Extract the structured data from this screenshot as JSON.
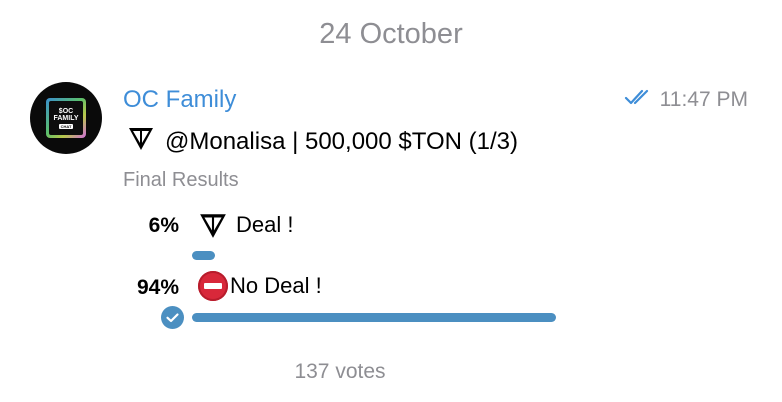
{
  "date_header": "24 October",
  "message": {
    "avatar": {
      "line1": "$OC",
      "line2": "FAMILY",
      "tag": "CHAT"
    },
    "sender": "OC Family",
    "time": "11:47 PM",
    "status_icon": "double-check-icon",
    "question": "@Monalisa | 500,000 $TON (1/3)"
  },
  "poll": {
    "state_label": "Final Results",
    "options": [
      {
        "percent": "6%",
        "label": "Deal !",
        "icon": "ton-logo-icon",
        "fraction": 0.06,
        "selected": false
      },
      {
        "percent": "94%",
        "label": "No Deal !",
        "icon": "no-entry-icon",
        "fraction": 0.94,
        "selected": true
      }
    ],
    "votes": "137 votes"
  },
  "colors": {
    "accent": "#3e8dd8",
    "bar": "#4b8fc1",
    "muted": "#8e8e93"
  }
}
